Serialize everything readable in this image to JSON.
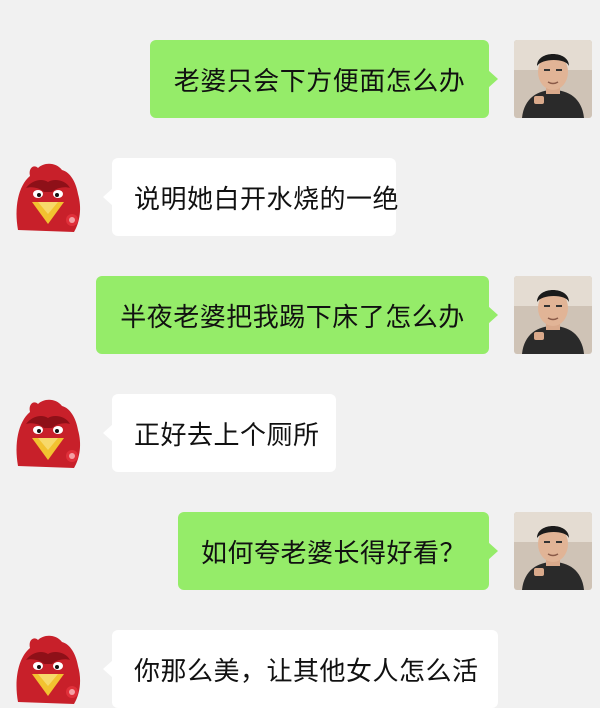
{
  "colors": {
    "background": "#f1f1f1",
    "outgoing_bubble": "#95ec69",
    "incoming_bubble": "#ffffff",
    "text": "#111111"
  },
  "avatars": {
    "me": "person-photo-icon",
    "bot": "red-eagle-mascot-icon"
  },
  "messages": [
    {
      "side": "out",
      "text": "老婆只会下方便面怎么办"
    },
    {
      "side": "in",
      "text": "说明她白开水烧的一绝"
    },
    {
      "side": "out",
      "text": "半夜老婆把我踢下床了怎么办"
    },
    {
      "side": "in",
      "text": "正好去上个厕所"
    },
    {
      "side": "out",
      "text": "如何夸老婆长得好看？"
    },
    {
      "side": "in",
      "text": "你那么美，让其他女人怎么活"
    }
  ]
}
